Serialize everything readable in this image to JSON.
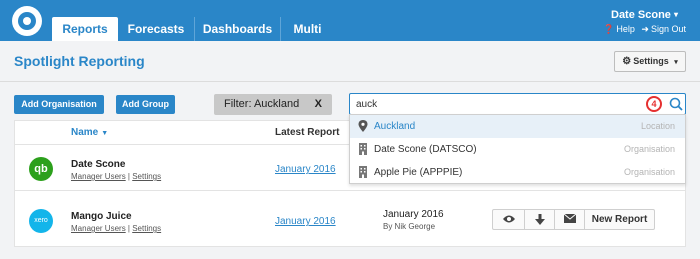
{
  "header": {
    "tabs": [
      {
        "label": "Reports",
        "active": true
      },
      {
        "label": "Forecasts",
        "active": false
      },
      {
        "label": "Dashboards",
        "active": false
      },
      {
        "label": "Multi",
        "active": false
      }
    ],
    "user_name": "Date Scone",
    "help_label": "Help",
    "signout_label": "Sign Out"
  },
  "page": {
    "title": "Spotlight Reporting",
    "settings_label": "Settings"
  },
  "actions": {
    "add_org_label": "Add Organisation",
    "add_group_label": "Add Group",
    "filter_label": "Filter: Auckland",
    "filter_clear": "X"
  },
  "search": {
    "value": "auck",
    "badge": "4",
    "suggestions": [
      {
        "label": "Auckland",
        "type": "Location",
        "icon": "location-pin-icon",
        "highlighted": true
      },
      {
        "label": "Date Scone (DATSCO)",
        "type": "Organisation",
        "icon": "building-icon",
        "highlighted": false
      },
      {
        "label": "Apple Pie (APPPIE)",
        "type": "Organisation",
        "icon": "building-icon",
        "highlighted": false
      }
    ]
  },
  "table": {
    "col_name": "Name",
    "col_latest": "Latest Report",
    "rows": [
      {
        "name": "Date Scone",
        "icon_text": "qb",
        "manager_users": "Manager Users",
        "settings": "Settings",
        "report": "January 2016"
      },
      {
        "name": "Mango Juice",
        "icon_text": "xero",
        "manager_users": "Manager Users",
        "settings": "Settings",
        "report": "January 2016",
        "latest_date": "January 2016",
        "latest_by": "By Nik George",
        "new_report_label": "New Report"
      }
    ]
  },
  "colors": {
    "brand": "#2a86c8",
    "quickbooks": "#2ca01c",
    "xero": "#13b5ea",
    "badge": "#e53030"
  }
}
